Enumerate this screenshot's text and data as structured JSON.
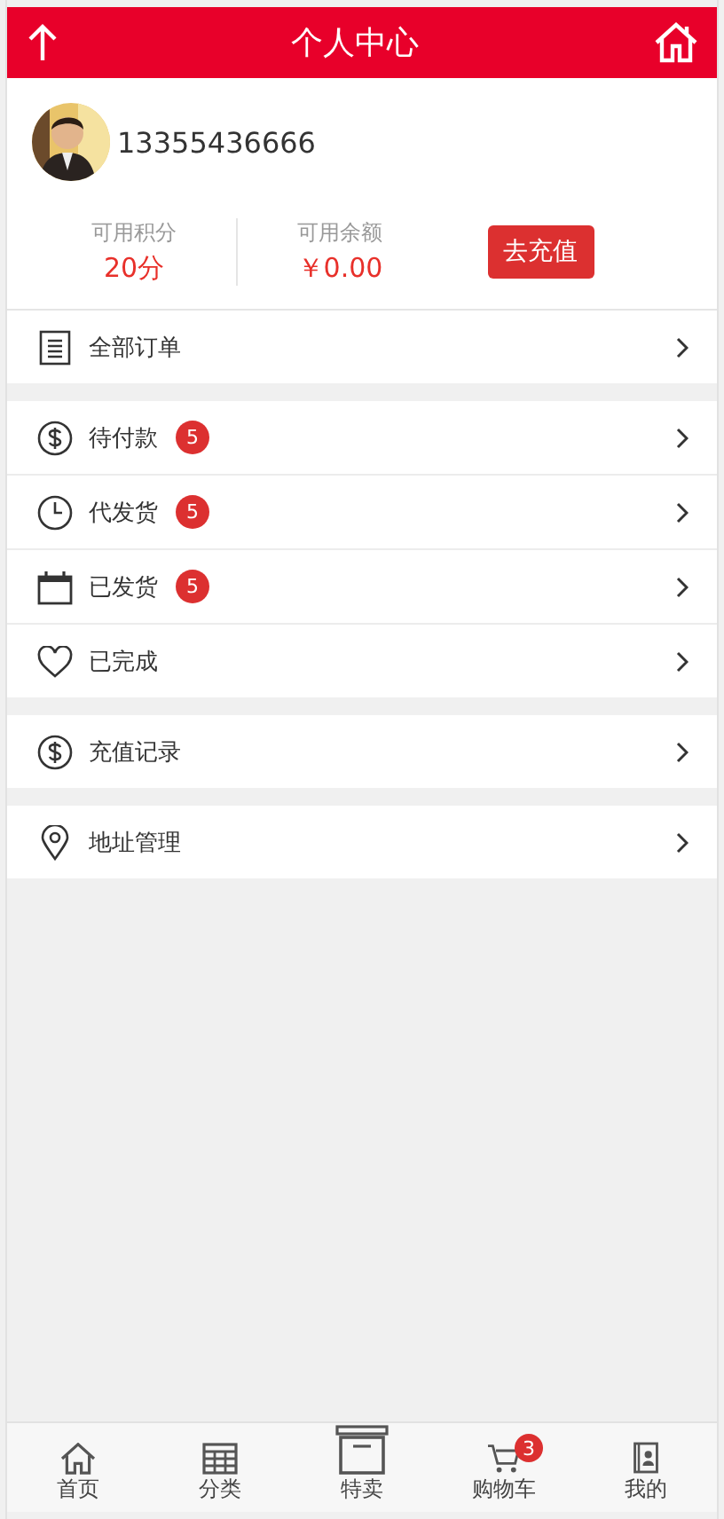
{
  "header": {
    "title": "个人中心"
  },
  "profile": {
    "phone": "13355436666"
  },
  "stats": [
    {
      "label": "可用积分",
      "value": "20分"
    },
    {
      "label": "可用余额",
      "value": "￥0.00"
    }
  ],
  "recharge_button": "去充值",
  "menu_groups": [
    [
      {
        "label": "全部订单"
      }
    ],
    [
      {
        "label": "待付款",
        "badge": "5"
      },
      {
        "label": "代发货",
        "badge": "5"
      },
      {
        "label": "已发货",
        "badge": "5"
      },
      {
        "label": "已完成"
      }
    ],
    [
      {
        "label": "充值记录"
      }
    ],
    [
      {
        "label": "地址管理"
      }
    ]
  ],
  "tab_bar": [
    {
      "label": "首页"
    },
    {
      "label": "分类"
    },
    {
      "label": "特卖"
    },
    {
      "label": "购物车",
      "badge": "3"
    },
    {
      "label": "我的"
    }
  ]
}
